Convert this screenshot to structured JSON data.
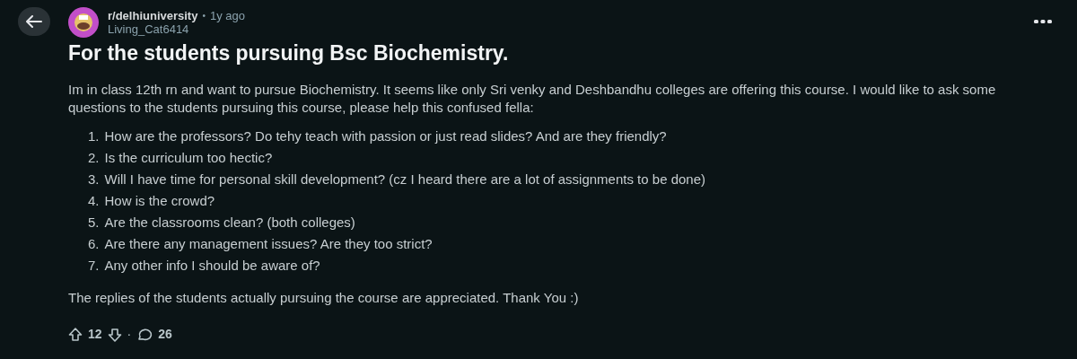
{
  "post": {
    "subreddit": "r/delhiuniversity",
    "separator": "•",
    "age": "1y ago",
    "author": "Living_Cat6414",
    "title": "For the students pursuing Bsc Biochemistry.",
    "intro": "Im in class 12th rn and want to pursue Biochemistry. It seems like only Sri venky and Deshbandhu colleges are offering this course. I would like to ask some questions to the students pursuing this course, please help this confused fella:",
    "questions": [
      {
        "number": "1.",
        "text": "How are the professors? Do tehy teach with passion or just read slides? And are they friendly?"
      },
      {
        "number": "2.",
        "text": "Is the curriculum too hectic?"
      },
      {
        "number": "3.",
        "text": "Will I have time for personal skill development? (cz I heard there are a lot of assignments to be done)"
      },
      {
        "number": "4.",
        "text": "How is the crowd?"
      },
      {
        "number": "5.",
        "text": "Are the classrooms clean? (both colleges)"
      },
      {
        "number": "6.",
        "text": "Are there any management issues? Are they too strict?"
      },
      {
        "number": "7.",
        "text": "Any other info I should be aware of?"
      }
    ],
    "outro": "The replies of the students actually pursuing the course are appreciated. Thank You :)",
    "actions": {
      "votes": "12",
      "separator": "·",
      "comments": "26"
    }
  }
}
